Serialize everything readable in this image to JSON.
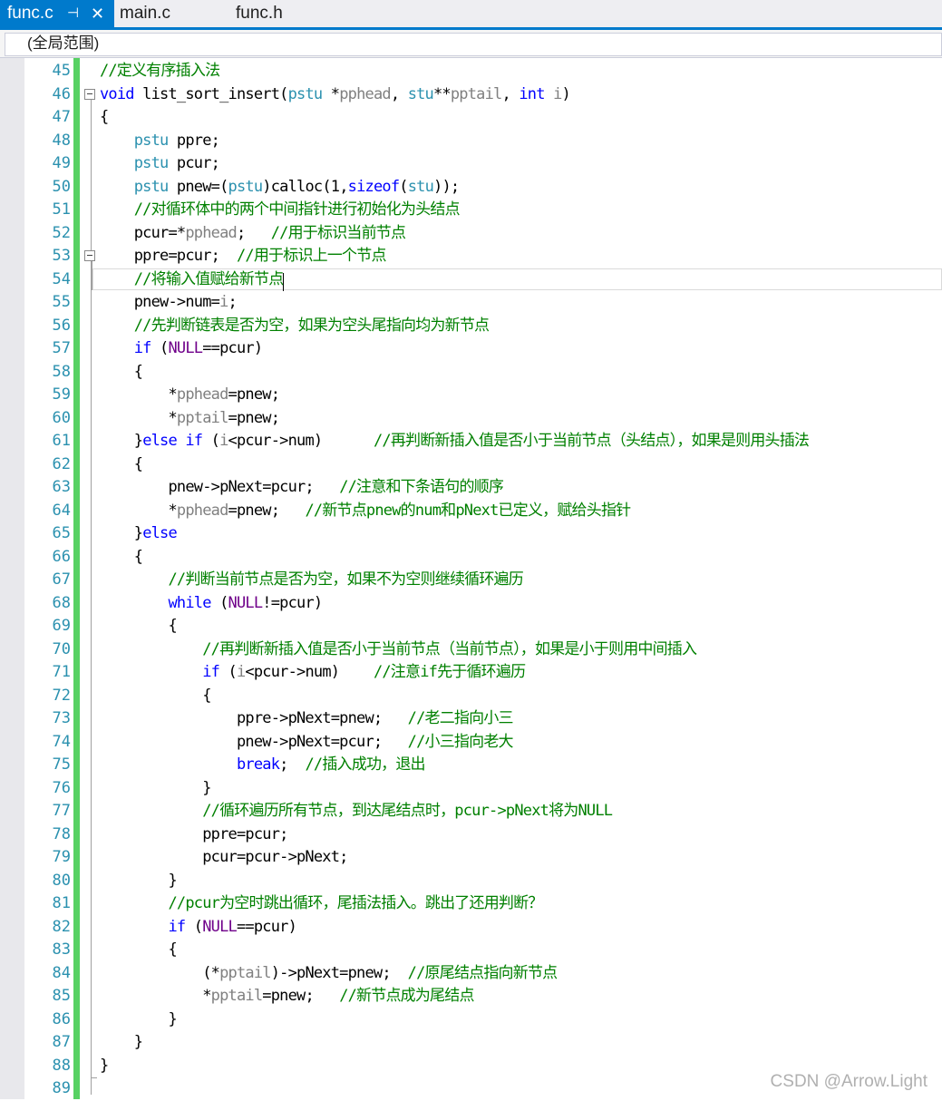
{
  "tabs": [
    {
      "label": "func.c",
      "active": true
    },
    {
      "label": "main.c",
      "active": false
    },
    {
      "label": "func.h",
      "active": false
    }
  ],
  "tab_icons": {
    "pin": "⊣",
    "close": "✕"
  },
  "scope": {
    "label": "(全局范围)"
  },
  "watermark": "CSDN @Arrow.Light",
  "colors": {
    "accent": "#007acc",
    "change_bar": "#57d163",
    "keyword": "#0000ff",
    "type": "#2b91af",
    "comment": "#008000",
    "param": "#808080",
    "macro": "#6f008a"
  },
  "lines": [
    {
      "n": "45",
      "t": [
        [
          "cm",
          "//定义有序插入法"
        ]
      ]
    },
    {
      "n": "46",
      "t": [
        [
          "kw",
          "void"
        ],
        [
          "tx",
          " list_sort_insert("
        ],
        [
          "ty",
          "pstu"
        ],
        [
          "tx",
          " *"
        ],
        [
          "prm",
          "pphead"
        ],
        [
          "tx",
          ", "
        ],
        [
          "ty",
          "stu"
        ],
        [
          "tx",
          "**"
        ],
        [
          "prm",
          "pptail"
        ],
        [
          "tx",
          ", "
        ],
        [
          "kw",
          "int"
        ],
        [
          "tx",
          " "
        ],
        [
          "prm",
          "i"
        ],
        [
          "tx",
          ")"
        ]
      ]
    },
    {
      "n": "47",
      "t": [
        [
          "tx",
          "{"
        ]
      ]
    },
    {
      "n": "48",
      "t": [
        [
          "tx",
          "    "
        ],
        [
          "ty",
          "pstu"
        ],
        [
          "tx",
          " ppre;"
        ]
      ]
    },
    {
      "n": "49",
      "t": [
        [
          "tx",
          "    "
        ],
        [
          "ty",
          "pstu"
        ],
        [
          "tx",
          " pcur;"
        ]
      ]
    },
    {
      "n": "50",
      "t": [
        [
          "tx",
          "    "
        ],
        [
          "ty",
          "pstu"
        ],
        [
          "tx",
          " pnew=("
        ],
        [
          "ty",
          "pstu"
        ],
        [
          "tx",
          ")calloc(1,"
        ],
        [
          "kw",
          "sizeof"
        ],
        [
          "tx",
          "("
        ],
        [
          "ty",
          "stu"
        ],
        [
          "tx",
          "));"
        ]
      ]
    },
    {
      "n": "51",
      "t": [
        [
          "tx",
          "    "
        ],
        [
          "cm",
          "//对循环体中的两个中间指针进行初始化为头结点"
        ]
      ]
    },
    {
      "n": "52",
      "t": [
        [
          "tx",
          "    pcur=*"
        ],
        [
          "prm",
          "pphead"
        ],
        [
          "tx",
          ";   "
        ],
        [
          "cm",
          "//用于标识当前节点"
        ]
      ]
    },
    {
      "n": "53",
      "t": [
        [
          "tx",
          "    ppre=pcur;  "
        ],
        [
          "cm",
          "//用于标识上一个节点"
        ]
      ]
    },
    {
      "n": "54",
      "t": [
        [
          "tx",
          "    "
        ],
        [
          "cm",
          "//将输入值赋给新节点"
        ]
      ]
    },
    {
      "n": "55",
      "t": [
        [
          "tx",
          "    pnew->num="
        ],
        [
          "prm",
          "i"
        ],
        [
          "tx",
          ";"
        ]
      ]
    },
    {
      "n": "56",
      "t": [
        [
          "tx",
          "    "
        ],
        [
          "cm",
          "//先判断链表是否为空，如果为空头尾指向均为新节点"
        ]
      ]
    },
    {
      "n": "57",
      "t": [
        [
          "tx",
          "    "
        ],
        [
          "kw",
          "if"
        ],
        [
          "tx",
          " ("
        ],
        [
          "mac",
          "NULL"
        ],
        [
          "tx",
          "==pcur)"
        ]
      ]
    },
    {
      "n": "58",
      "t": [
        [
          "tx",
          "    {"
        ]
      ]
    },
    {
      "n": "59",
      "t": [
        [
          "tx",
          "        *"
        ],
        [
          "prm",
          "pphead"
        ],
        [
          "tx",
          "=pnew;"
        ]
      ]
    },
    {
      "n": "60",
      "t": [
        [
          "tx",
          "        *"
        ],
        [
          "prm",
          "pptail"
        ],
        [
          "tx",
          "=pnew;"
        ]
      ]
    },
    {
      "n": "61",
      "t": [
        [
          "tx",
          "    }"
        ],
        [
          "kw",
          "else if"
        ],
        [
          "tx",
          " ("
        ],
        [
          "prm",
          "i"
        ],
        [
          "tx",
          "<pcur->num)      "
        ],
        [
          "cm",
          "//再判断新插入值是否小于当前节点（头结点），如果是则用头插法"
        ]
      ]
    },
    {
      "n": "62",
      "t": [
        [
          "tx",
          "    {"
        ]
      ]
    },
    {
      "n": "63",
      "t": [
        [
          "tx",
          "        pnew->pNext=pcur;   "
        ],
        [
          "cm",
          "//注意和下条语句的顺序"
        ]
      ]
    },
    {
      "n": "64",
      "t": [
        [
          "tx",
          "        *"
        ],
        [
          "prm",
          "pphead"
        ],
        [
          "tx",
          "=pnew;   "
        ],
        [
          "cm",
          "//新节点pnew的num和pNext已定义，赋给头指针"
        ]
      ]
    },
    {
      "n": "65",
      "t": [
        [
          "tx",
          "    }"
        ],
        [
          "kw",
          "else"
        ]
      ]
    },
    {
      "n": "66",
      "t": [
        [
          "tx",
          "    {"
        ]
      ]
    },
    {
      "n": "67",
      "t": [
        [
          "tx",
          "        "
        ],
        [
          "cm",
          "//判断当前节点是否为空，如果不为空则继续循环遍历"
        ]
      ]
    },
    {
      "n": "68",
      "t": [
        [
          "tx",
          "        "
        ],
        [
          "kw",
          "while"
        ],
        [
          "tx",
          " ("
        ],
        [
          "mac",
          "NULL"
        ],
        [
          "tx",
          "!=pcur)"
        ]
      ]
    },
    {
      "n": "69",
      "t": [
        [
          "tx",
          "        {"
        ]
      ]
    },
    {
      "n": "70",
      "t": [
        [
          "tx",
          "            "
        ],
        [
          "cm",
          "//再判断新插入值是否小于当前节点（当前节点），如果是小于则用中间插入"
        ]
      ]
    },
    {
      "n": "71",
      "t": [
        [
          "tx",
          "            "
        ],
        [
          "kw",
          "if"
        ],
        [
          "tx",
          " ("
        ],
        [
          "prm",
          "i"
        ],
        [
          "tx",
          "<pcur->num)    "
        ],
        [
          "cm",
          "//注意if先于循环遍历"
        ]
      ]
    },
    {
      "n": "72",
      "t": [
        [
          "tx",
          "            {"
        ]
      ]
    },
    {
      "n": "73",
      "t": [
        [
          "tx",
          "                ppre->pNext=pnew;   "
        ],
        [
          "cm",
          "//老二指向小三"
        ]
      ]
    },
    {
      "n": "74",
      "t": [
        [
          "tx",
          "                pnew->pNext=pcur;   "
        ],
        [
          "cm",
          "//小三指向老大"
        ]
      ]
    },
    {
      "n": "75",
      "t": [
        [
          "tx",
          "                "
        ],
        [
          "kw",
          "break"
        ],
        [
          "tx",
          ";  "
        ],
        [
          "cm",
          "//插入成功，退出"
        ]
      ]
    },
    {
      "n": "76",
      "t": [
        [
          "tx",
          "            }"
        ]
      ]
    },
    {
      "n": "77",
      "t": [
        [
          "tx",
          "            "
        ],
        [
          "cm",
          "//循环遍历所有节点，到达尾结点时，pcur->pNext将为NULL"
        ]
      ]
    },
    {
      "n": "78",
      "t": [
        [
          "tx",
          "            ppre=pcur;"
        ]
      ]
    },
    {
      "n": "79",
      "t": [
        [
          "tx",
          "            pcur=pcur->pNext;"
        ]
      ]
    },
    {
      "n": "80",
      "t": [
        [
          "tx",
          "        }"
        ]
      ]
    },
    {
      "n": "81",
      "t": [
        [
          "tx",
          "        "
        ],
        [
          "cm",
          "//pcur为空时跳出循环，尾插法插入。跳出了还用判断？"
        ]
      ]
    },
    {
      "n": "82",
      "t": [
        [
          "tx",
          "        "
        ],
        [
          "kw",
          "if"
        ],
        [
          "tx",
          " ("
        ],
        [
          "mac",
          "NULL"
        ],
        [
          "tx",
          "==pcur)"
        ]
      ]
    },
    {
      "n": "83",
      "t": [
        [
          "tx",
          "        {"
        ]
      ]
    },
    {
      "n": "84",
      "t": [
        [
          "tx",
          "            (*"
        ],
        [
          "prm",
          "pptail"
        ],
        [
          "tx",
          ")->pNext=pnew;  "
        ],
        [
          "cm",
          "//原尾结点指向新节点"
        ]
      ]
    },
    {
      "n": "85",
      "t": [
        [
          "tx",
          "            *"
        ],
        [
          "prm",
          "pptail"
        ],
        [
          "tx",
          "=pnew;   "
        ],
        [
          "cm",
          "//新节点成为尾结点"
        ]
      ]
    },
    {
      "n": "86",
      "t": [
        [
          "tx",
          "        }"
        ]
      ]
    },
    {
      "n": "87",
      "t": [
        [
          "tx",
          "    }"
        ]
      ]
    },
    {
      "n": "88",
      "t": [
        [
          "tx",
          "}"
        ]
      ]
    },
    {
      "n": "89",
      "t": []
    }
  ]
}
